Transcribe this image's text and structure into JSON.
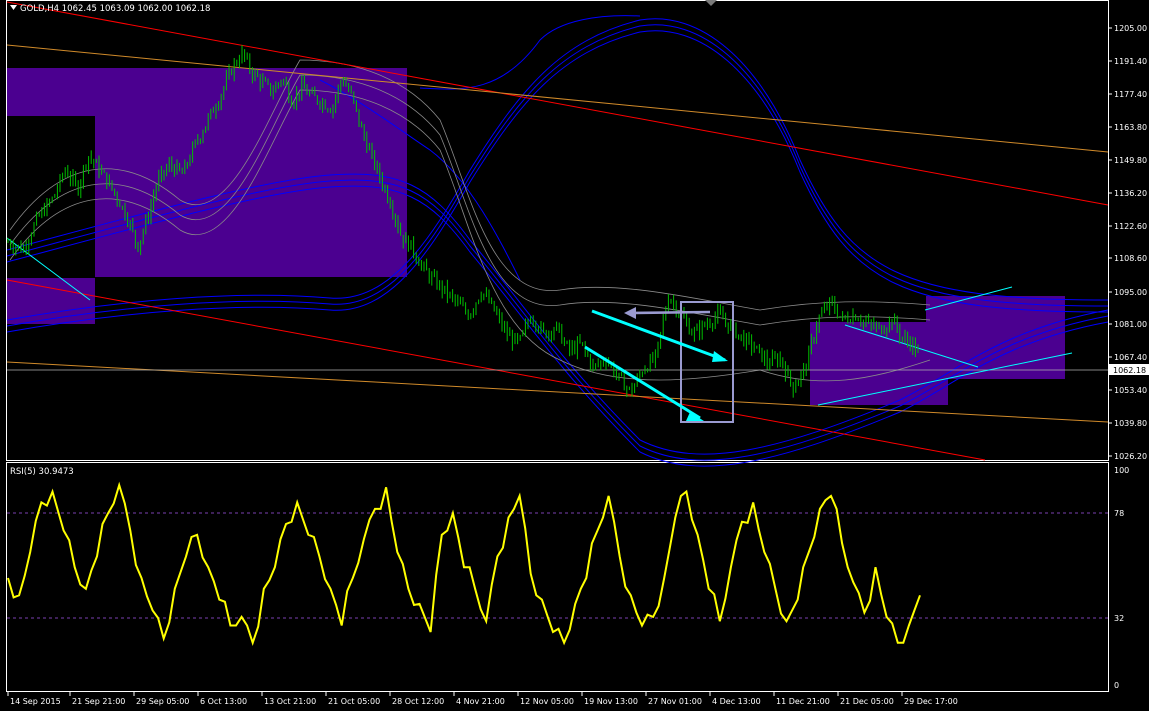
{
  "header": {
    "symbol_text": "GOLD,H4  1062.45 1063.09 1062.00 1062.18",
    "rsi_text": "RSI(5) 30.9473"
  },
  "colors": {
    "background": "#000000",
    "axis": "#ffffff",
    "candles": "#00c000",
    "rsi": "#ffff00",
    "box": "#4b0090",
    "envelope": "#0000ff",
    "bands": "#8a8a8a",
    "channel_red": "#ff0000",
    "channel_orange": "#d08a2a",
    "arrow_cyan": "#00ffff",
    "arrow_slate": "#9a9ad0",
    "current_price_line": "#b0b0b0"
  },
  "chart_data": {
    "type": "candlestick",
    "symbol": "GOLD",
    "timeframe": "H4",
    "ylim": [
      1020.0,
      1210.0
    ],
    "price_ticks": [
      "1205.00",
      "1191.40",
      "1177.40",
      "1163.80",
      "1149.80",
      "1136.20",
      "1122.60",
      "1108.60",
      "1095.00",
      "1081.00",
      "1067.40",
      "1053.40",
      "1039.80",
      "1026.20"
    ],
    "current_price": "1062.18",
    "x_ticks": [
      "14 Sep 2015",
      "21 Sep 21:00",
      "29 Sep 05:00",
      "6 Oct 13:00",
      "13 Oct 21:00",
      "21 Oct 05:00",
      "28 Oct 12:00",
      "4 Nov 21:00",
      "12 Nov 05:00",
      "19 Nov 13:00",
      "27 Nov 01:00",
      "4 Dec 13:00",
      "11 Dec 21:00",
      "21 Dec 05:00",
      "29 Dec 17:00"
    ],
    "close_path": [
      [
        0,
        1110
      ],
      [
        0.6,
        1107
      ],
      [
        1.2,
        1120
      ],
      [
        1.8,
        1128
      ],
      [
        2.3,
        1140
      ],
      [
        2.8,
        1132
      ],
      [
        3.2,
        1146
      ],
      [
        3.6,
        1141
      ],
      [
        4,
        1135
      ],
      [
        4.4,
        1128
      ],
      [
        4.8,
        1120
      ],
      [
        5.2,
        1108
      ],
      [
        5.6,
        1120
      ],
      [
        6,
        1135
      ],
      [
        6.5,
        1142
      ],
      [
        7,
        1138
      ],
      [
        7.5,
        1150
      ],
      [
        8,
        1160
      ],
      [
        8.5,
        1170
      ],
      [
        9,
        1182
      ],
      [
        9.4,
        1188
      ],
      [
        9.8,
        1180
      ],
      [
        10.2,
        1176
      ],
      [
        10.6,
        1172
      ],
      [
        11,
        1178
      ],
      [
        11.4,
        1168
      ],
      [
        11.8,
        1174
      ],
      [
        12.2,
        1170
      ],
      [
        12.6,
        1168
      ],
      [
        13,
        1165
      ],
      [
        13.4,
        1178
      ],
      [
        13.8,
        1170
      ],
      [
        14.2,
        1156
      ],
      [
        14.6,
        1145
      ],
      [
        15,
        1135
      ],
      [
        15.4,
        1125
      ],
      [
        15.8,
        1112
      ],
      [
        16.2,
        1108
      ],
      [
        16.6,
        1100
      ],
      [
        17,
        1095
      ],
      [
        17.5,
        1090
      ],
      [
        18,
        1085
      ],
      [
        18.5,
        1080
      ],
      [
        19,
        1090
      ],
      [
        19.5,
        1082
      ],
      [
        20,
        1072
      ],
      [
        20.5,
        1068
      ],
      [
        21,
        1080
      ],
      [
        21.5,
        1072
      ],
      [
        22,
        1075
      ],
      [
        22.5,
        1065
      ],
      [
        23,
        1068
      ],
      [
        23.5,
        1058
      ],
      [
        24,
        1062
      ],
      [
        24.5,
        1054
      ],
      [
        25,
        1048
      ],
      [
        25.5,
        1058
      ],
      [
        26,
        1062
      ],
      [
        26.5,
        1088
      ],
      [
        27,
        1080
      ],
      [
        27.5,
        1072
      ],
      [
        28,
        1076
      ],
      [
        28.5,
        1080
      ],
      [
        29,
        1075
      ],
      [
        29.5,
        1070
      ],
      [
        30,
        1066
      ],
      [
        30.5,
        1060
      ],
      [
        31,
        1062
      ],
      [
        31.5,
        1050
      ],
      [
        32,
        1058
      ],
      [
        32.5,
        1078
      ],
      [
        33,
        1085
      ],
      [
        33.5,
        1078
      ],
      [
        34,
        1080
      ],
      [
        34.5,
        1076
      ],
      [
        35,
        1074
      ],
      [
        35.5,
        1078
      ],
      [
        35.9,
        1070
      ],
      [
        36.3,
        1068
      ],
      [
        36.6,
        1062
      ]
    ],
    "rsi": {
      "label": "RSI(5)",
      "current": 30.9473,
      "ylim": [
        0,
        100
      ],
      "levels": [
        100,
        78,
        32,
        0
      ],
      "values": [
        50,
        42,
        62,
        85,
        90,
        72,
        55,
        45,
        60,
        80,
        93,
        72,
        50,
        35,
        22,
        45,
        60,
        70,
        55,
        40,
        28,
        32,
        20,
        45,
        55,
        75,
        85,
        70,
        60,
        45,
        28,
        50,
        68,
        82,
        92,
        62,
        45,
        38,
        25,
        70,
        80,
        55,
        45,
        30,
        60,
        78,
        88,
        52,
        40,
        25,
        20,
        38,
        50,
        72,
        88,
        60,
        42,
        28,
        32,
        50,
        78,
        90,
        70,
        45,
        30,
        55,
        76,
        85,
        62,
        45,
        30,
        40,
        62,
        82,
        88,
        66,
        48,
        34,
        55,
        32,
        20,
        28,
        42
      ]
    }
  }
}
